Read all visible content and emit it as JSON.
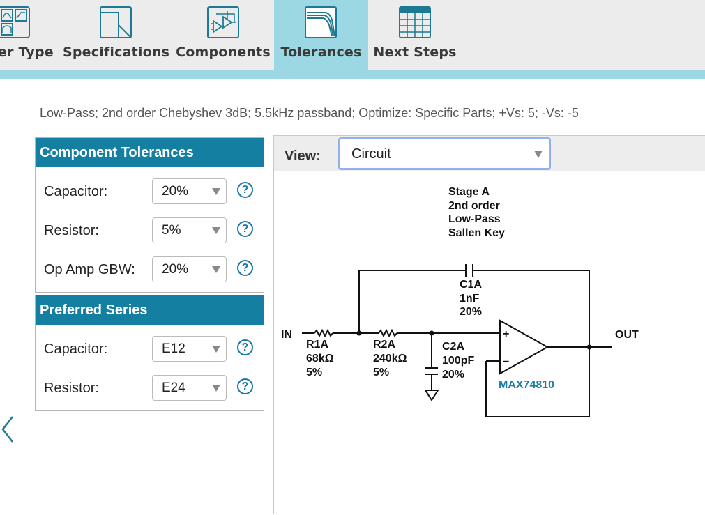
{
  "tabs": [
    {
      "label": "er Type",
      "icon": "filter-type-icon",
      "active": false
    },
    {
      "label": "Specifications",
      "icon": "specifications-icon",
      "active": false
    },
    {
      "label": "Components",
      "icon": "components-icon",
      "active": false
    },
    {
      "label": "Tolerances",
      "icon": "tolerances-icon",
      "active": true
    },
    {
      "label": "Next Steps",
      "icon": "next-steps-icon",
      "active": false
    }
  ],
  "summary": "Low-Pass; 2nd order Chebyshev 3dB; 5.5kHz passband; Optimize: Specific Parts; +Vs: 5; -Vs: -5",
  "component_tolerances": {
    "title": "Component Tolerances",
    "rows": [
      {
        "label": "Capacitor:",
        "value": "20%"
      },
      {
        "label": "Resistor:",
        "value": "5%"
      },
      {
        "label": "Op Amp GBW:",
        "value": "20%"
      }
    ]
  },
  "preferred_series": {
    "title": "Preferred Series",
    "rows": [
      {
        "label": "Capacitor:",
        "value": "E12"
      },
      {
        "label": "Resistor:",
        "value": "E24"
      }
    ]
  },
  "help_glyph": "?",
  "view": {
    "label": "View:",
    "value": "Circuit"
  },
  "schematic": {
    "stage_lines": [
      "Stage A",
      "2nd order",
      "Low-Pass",
      "Sallen Key"
    ],
    "input_label": "IN",
    "output_label": "OUT",
    "r1": [
      "R1A",
      "68kΩ",
      "5%"
    ],
    "r2": [
      "R2A",
      "240kΩ",
      "5%"
    ],
    "c1": [
      "C1A",
      "1nF",
      "20%"
    ],
    "c2": [
      "C2A",
      "100pF",
      "20%"
    ],
    "opamp_part": "MAX74810",
    "opamp_plus": "+",
    "opamp_minus": "−"
  },
  "colors": {
    "accent": "#147fa0",
    "tab_active": "#9bd8e3",
    "tab_bar": "#ececec",
    "help": "#1678a6",
    "chip_label": "#1a7fa6"
  }
}
